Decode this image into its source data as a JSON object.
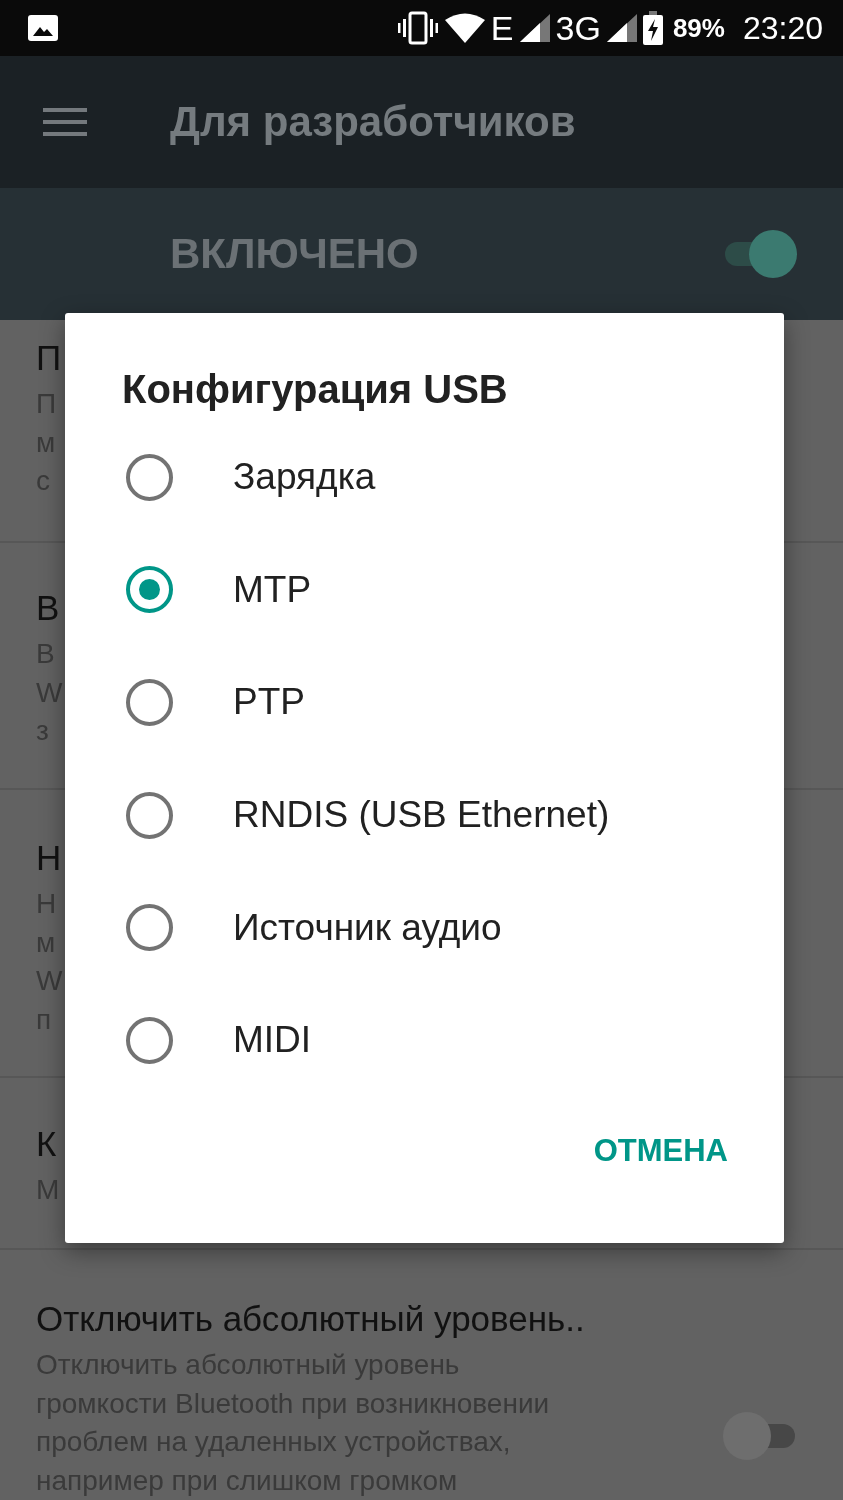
{
  "status_bar": {
    "network": [
      "E",
      "3G"
    ],
    "battery": "89%",
    "time": "23:20"
  },
  "toolbar": {
    "title": "Для разработчиков"
  },
  "master_switch": {
    "label": "ВКЛЮЧЕНО",
    "on": true
  },
  "settings": [
    {
      "kind": "plain",
      "title": "П",
      "summary_lines": [
        "П",
        "м",
        "с"
      ]
    },
    {
      "kind": "plain",
      "title": "В",
      "summary_lines": [
        "В",
        "W",
        "з"
      ]
    },
    {
      "kind": "plain",
      "title": "Н",
      "summary_lines": [
        "Н",
        "м",
        "W",
        "п"
      ]
    },
    {
      "kind": "plain",
      "title": "К",
      "summary_lines": [
        "М"
      ]
    },
    {
      "kind": "switch",
      "title": "Отключить абсолютный уровень..",
      "summary_lines": [
        "Отключить абсолютный уровень",
        "громкости Bluetooth при возникновении",
        "проблем на удаленных устройствах,",
        "например при слишком громком"
      ],
      "on": false
    }
  ],
  "dialog": {
    "title": "Конфигурация USB",
    "options": [
      {
        "label": "Зарядка",
        "selected": false
      },
      {
        "label": "MTP",
        "selected": true
      },
      {
        "label": "PTP",
        "selected": false
      },
      {
        "label": "RNDIS (USB Ethernet)",
        "selected": false
      },
      {
        "label": "Источник аудио",
        "selected": false
      },
      {
        "label": "MIDI",
        "selected": false
      }
    ],
    "button": "ОТМЕНА"
  }
}
